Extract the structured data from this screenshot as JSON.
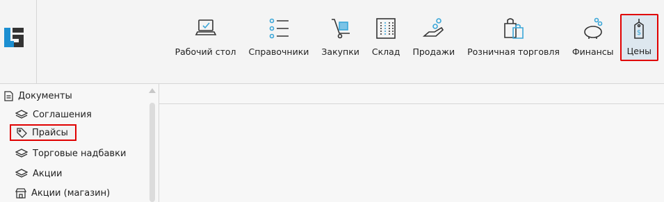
{
  "toolbar": {
    "items": [
      {
        "label": "Рабочий стол",
        "icon": "desktop-laptop-icon"
      },
      {
        "label": "Справочники",
        "icon": "list-icon"
      },
      {
        "label": "Закупки",
        "icon": "cart-icon"
      },
      {
        "label": "Склад",
        "icon": "warehouse-building-icon"
      },
      {
        "label": "Продажи",
        "icon": "sales-hand-coins-icon"
      },
      {
        "label": "Розничная торговля",
        "icon": "shopping-bags-icon"
      },
      {
        "label": "Финансы",
        "icon": "piggy-bank-icon"
      },
      {
        "label": "Цены",
        "icon": "price-tag-icon",
        "active": true
      }
    ]
  },
  "sidebar": {
    "root_label": "Документы",
    "items": [
      {
        "label": "Соглашения",
        "icon": "layers-icon"
      },
      {
        "label": "Прайсы",
        "icon": "tag-icon",
        "highlighted": true
      },
      {
        "label": "Торговые надбавки",
        "icon": "layers-icon"
      },
      {
        "label": "Акции",
        "icon": "layers-icon"
      },
      {
        "label": "Акции (магазин)",
        "icon": "store-icon"
      }
    ]
  },
  "colors": {
    "highlight_border": "#e00000",
    "active_bg": "#dde7ef",
    "accent_blue": "#3aa6d8",
    "logo_blue": "#1c8fd1"
  }
}
